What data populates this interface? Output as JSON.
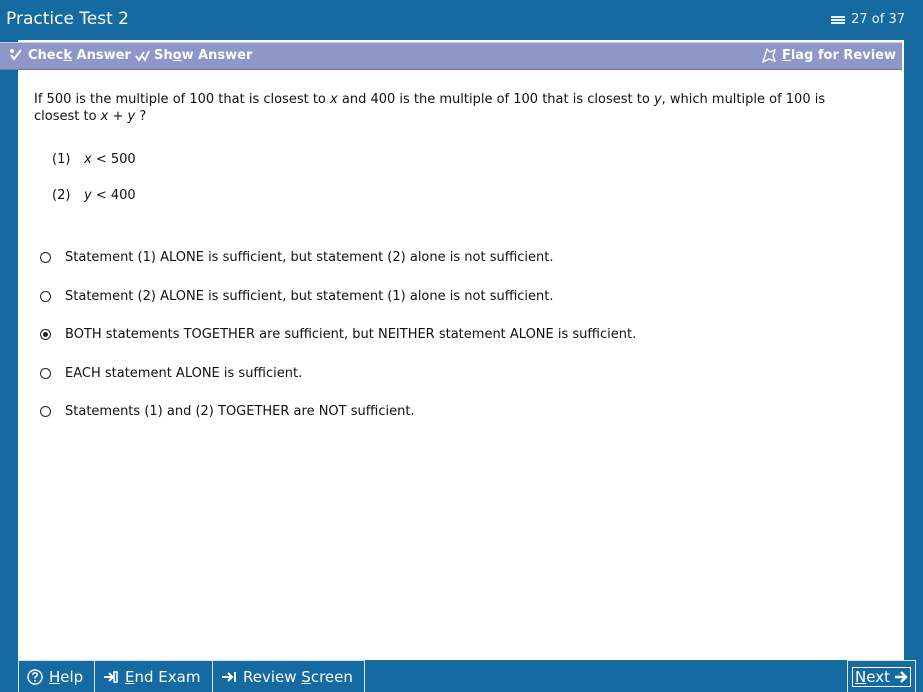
{
  "header": {
    "title": "Practice Test 2",
    "counter": "27 of 37",
    "counter_icon": "pages-icon"
  },
  "toolbar": {
    "check_answer": {
      "pre": "Chec",
      "key": "k",
      "post": " Answer",
      "icon": "check-answer-icon"
    },
    "show_answer": {
      "pre": "Sh",
      "key": "o",
      "post": "w Answer",
      "icon": "show-answer-icon"
    },
    "flag_review": {
      "pre": "",
      "key": "F",
      "post": "lag for Review",
      "icon": "flag-icon"
    },
    "bar_color": "#8e97c8"
  },
  "question": {
    "text_parts": [
      "If 500 is the multiple of 100 that is closest to ",
      "x",
      " and 400 is the multiple of 100 that is closest to ",
      "y",
      ", which multiple of 100 is closest to ",
      "x + y",
      " ?"
    ],
    "statements": [
      {
        "num": "(1)",
        "var": "x",
        "rest": " < 500"
      },
      {
        "num": "(2)",
        "var": "y",
        "rest": " < 400"
      }
    ]
  },
  "options": [
    {
      "label": "Statement (1) ALONE is sufficient, but statement (2) alone is not sufficient.",
      "selected": false
    },
    {
      "label": "Statement (2) ALONE is sufficient, but statement (1) alone is not sufficient.",
      "selected": false
    },
    {
      "label": "BOTH statements TOGETHER are sufficient, but NEITHER statement ALONE is sufficient.",
      "selected": true
    },
    {
      "label": "EACH statement ALONE is sufficient.",
      "selected": false
    },
    {
      "label": "Statements (1) and (2) TOGETHER are NOT sufficient.",
      "selected": false
    }
  ],
  "footer": {
    "help": {
      "key": "H",
      "post": "elp",
      "icon": "help-icon"
    },
    "end_exam": {
      "key": "E",
      "post": "nd Exam",
      "icon": "end-exam-icon"
    },
    "review_screen": {
      "pre": "Review ",
      "key": "S",
      "post": "creen",
      "icon": "review-screen-icon"
    },
    "next": {
      "key": "N",
      "post": "ext",
      "icon": "next-arrow-icon"
    }
  },
  "colors": {
    "frame_blue": "#156aa1",
    "toolbar_purple": "#8e97c8",
    "content_bg": "#ffffff"
  }
}
